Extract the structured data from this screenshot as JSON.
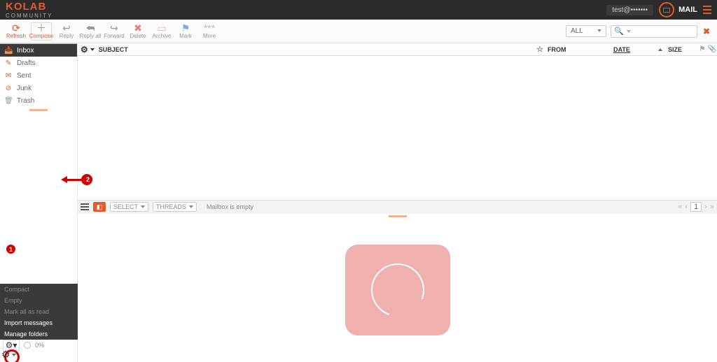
{
  "brand": {
    "name": "KOLAB",
    "tag": "COMMUNITY"
  },
  "header": {
    "user": "test@•••••••",
    "appLabel": "MAIL"
  },
  "toolbar": {
    "refresh": "Refresh",
    "compose": "Compose",
    "reply": "Reply",
    "replyAll": "Reply all",
    "forward": "Forward",
    "delete": "Delete",
    "archive": "Archive",
    "mark": "Mark",
    "more": "More",
    "filter": "ALL"
  },
  "folders": {
    "inbox": "Inbox",
    "drafts": "Drafts",
    "sent": "Sent",
    "junk": "Junk",
    "trash": "Trash"
  },
  "folderMenu": {
    "compact": "Compact",
    "empty": "Empty",
    "markAll": "Mark all as read",
    "import": "Import messages",
    "manage": "Manage folders"
  },
  "quota": {
    "label": "0%"
  },
  "list": {
    "cols": {
      "subject": "SUBJECT",
      "from": "FROM",
      "date": "DATE",
      "size": "SIZE"
    },
    "foot": {
      "select": "SELECT",
      "threads": "THREADS",
      "empty": "Mailbox is empty",
      "page": "1"
    }
  },
  "annotations": {
    "n1": "1",
    "n2": "2"
  }
}
